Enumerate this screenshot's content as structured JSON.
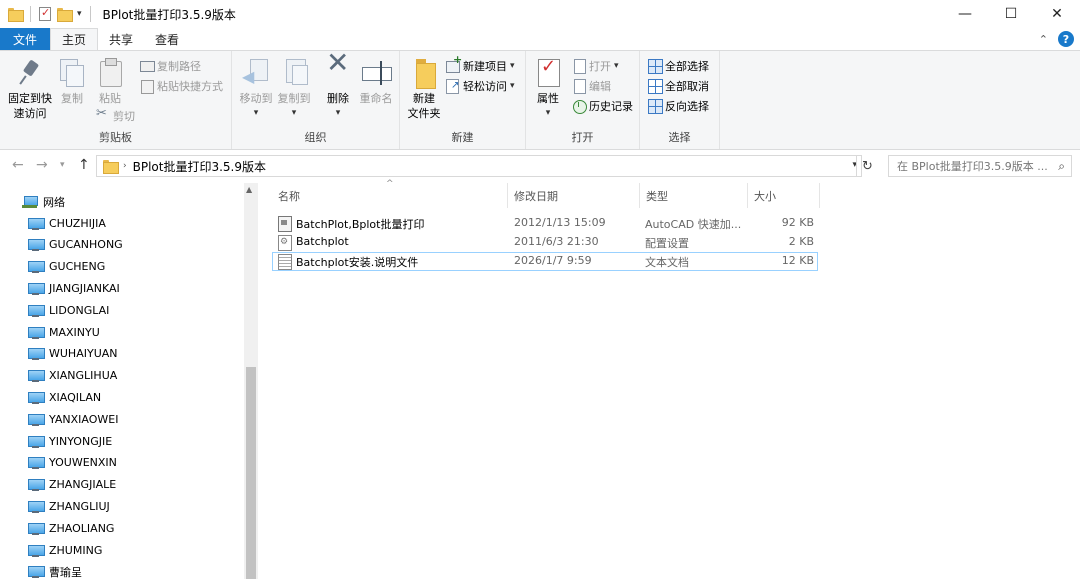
{
  "window": {
    "title": "BPlot批量打印3.5.9版本",
    "controls": {
      "minimize": "—",
      "maximize": "☐",
      "close": "✕"
    }
  },
  "ribbon_tabs": {
    "file": "文件",
    "home": "主页",
    "share": "共享",
    "view": "查看",
    "collapse_glyph": "⌃",
    "help_glyph": "?"
  },
  "ribbon": {
    "clipboard": {
      "label": "剪贴板",
      "pin": "固定到快速访问",
      "pin_line1": "固定到快",
      "pin_line2": "速访问",
      "copy": "复制",
      "paste": "粘贴",
      "copy_path": "复制路径",
      "paste_shortcut": "粘贴快捷方式",
      "cut": "剪切"
    },
    "organize": {
      "label": "组织",
      "move_to": "移动到",
      "copy_to": "复制到",
      "delete": "删除",
      "rename": "重命名"
    },
    "new": {
      "label": "新建",
      "new_folder_line1": "新建",
      "new_folder_line2": "文件夹",
      "new_item": "新建项目",
      "easy_access": "轻松访问"
    },
    "open": {
      "label": "打开",
      "properties": "属性",
      "open": "打开",
      "edit": "编辑",
      "history": "历史记录"
    },
    "select": {
      "label": "选择",
      "select_all": "全部选择",
      "select_none": "全部取消",
      "invert": "反向选择"
    }
  },
  "address": {
    "path": "BPlot批量打印3.5.9版本",
    "search_placeholder": "在 BPlot批量打印3.5.9版本 ..."
  },
  "nav_pane": {
    "root": "网络",
    "items": [
      "CHUZHIJIA",
      "GUCANHONG",
      "GUCHENG",
      "JIANGJIANKAI",
      "LIDONGLAI",
      "MAXINYU",
      "WUHAIYUAN",
      "XIANGLIHUA",
      "XIAQILAN",
      "YANXIAOWEI",
      "YINYONGJIE",
      "YOUWENXIN",
      "ZHANGJIALE",
      "ZHANGLIUJ",
      "ZHAOLIANG",
      "ZHUMING",
      "曹瑜呈"
    ]
  },
  "file_list": {
    "columns": {
      "name": "名称",
      "modified": "修改日期",
      "type": "类型",
      "size": "大小"
    },
    "rows": [
      {
        "name": "BatchPlot,Bplot批量打印",
        "modified": "2012/1/13 15:09",
        "type": "AutoCAD 快速加...",
        "size": "92 KB",
        "icon": "autocad-file-icon"
      },
      {
        "name": "Batchplot",
        "modified": "2011/6/3 21:30",
        "type": "配置设置",
        "size": "2 KB",
        "icon": "config-file-icon"
      },
      {
        "name": "Batchplot安装.说明文件",
        "modified": "2026/1/7 9:59",
        "type": "文本文档",
        "size": "12 KB",
        "icon": "text-file-icon",
        "selected": true
      }
    ]
  },
  "colors": {
    "accent": "#1979ca",
    "selection_border": "#99d1ff",
    "ribbon_bg": "#f5f6f7",
    "folder": "#f6cd5c"
  }
}
